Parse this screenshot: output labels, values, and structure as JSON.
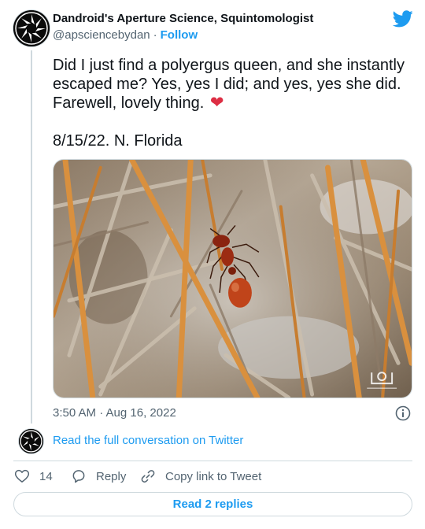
{
  "author": {
    "display_name": "Dandroid's Aperture Science, Squintomologist",
    "handle": "@apsciencebydan",
    "follow_label": "Follow"
  },
  "tweet": {
    "lines": [
      "Did I just find a polyergus queen, and she instantly",
      "escaped me? Yes, yes I did; and yes, yes she did.",
      "Farewell, lovely thing."
    ],
    "emoji": "❤",
    "date_line": "8/15/22. N. Florida"
  },
  "timestamp": "3:50 AM · Aug 16, 2022",
  "read_conversation_label": "Read the full conversation on Twitter",
  "actions": {
    "like_count": "14",
    "reply_label": "Reply",
    "copy_label": "Copy link to Tweet"
  },
  "read_replies_label": "Read 2 replies",
  "colors": {
    "accent": "#1d9bf0",
    "text": "#0f1419",
    "muted": "#536471",
    "border": "#cfd9de",
    "heart": "#dd2e44"
  },
  "icons": {
    "logo": "twitter-bird-icon",
    "info": "info-icon",
    "like": "heart-icon",
    "reply": "reply-bubble-icon",
    "copy": "link-icon"
  }
}
